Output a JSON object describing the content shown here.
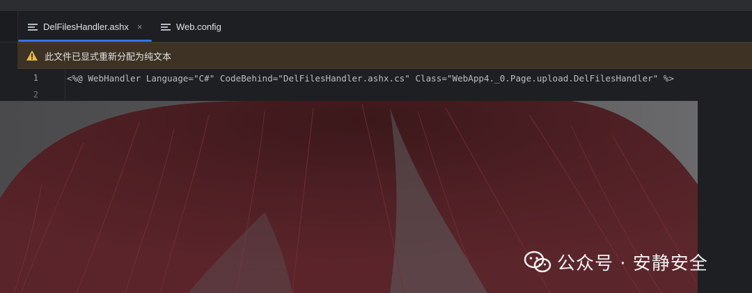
{
  "tabs": [
    {
      "label": "DelFilesHandler.ashx",
      "icon": "text-file-icon",
      "active": true,
      "close": "×"
    },
    {
      "label": "Web.config",
      "icon": "text-file-icon",
      "active": false
    }
  ],
  "banner": {
    "icon": "warning-icon",
    "message": "此文件已显式重新分配为纯文本",
    "accent": "#e5b94a"
  },
  "editor": {
    "line_numbers": [
      "1",
      "2"
    ],
    "lines": [
      "<%@ WebHandler Language=\"C#\" CodeBehind=\"DelFilesHandler.ashx.cs\" Class=\"WebApp4._0.Page.upload.DelFilesHandler\" %>",
      ""
    ]
  },
  "artwork": {
    "description_icon": "hair-illustration"
  },
  "watermark": {
    "icon": "wechat-icon",
    "text": "公众号 · 安静安全"
  }
}
